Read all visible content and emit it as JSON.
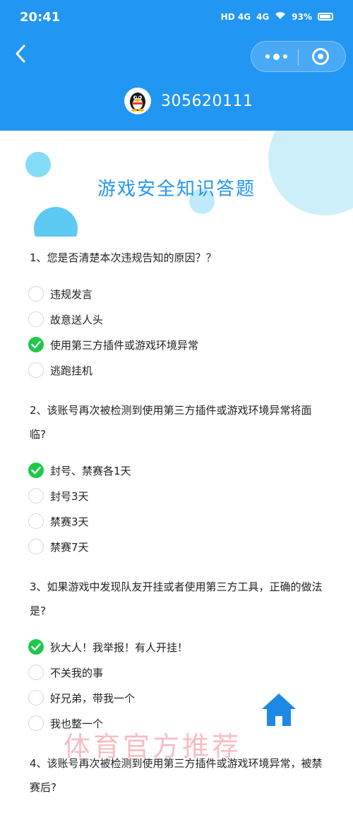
{
  "status_bar": {
    "time": "20:41",
    "network_1": "HD 4G",
    "network_2": "4G",
    "battery": "93%"
  },
  "nav": {
    "back_icon": "chevron-left-icon",
    "more_icon": "more-dots-icon",
    "close_icon": "target-close-icon"
  },
  "account": {
    "avatar_icon": "qq-penguin-icon",
    "number": "305620111"
  },
  "banner": {
    "title": "游戏安全知识答题"
  },
  "questions": [
    {
      "text": "1、您是否清楚本次违规告知的原因？？",
      "options": [
        {
          "label": "违规发言",
          "checked": false
        },
        {
          "label": "故意送人头",
          "checked": false
        },
        {
          "label": "使用第三方插件或游戏环境异常",
          "checked": true
        },
        {
          "label": "逃跑挂机",
          "checked": false
        }
      ]
    },
    {
      "text": "2、该账号再次被检测到使用第三方插件或游戏环境异常将面临?",
      "options": [
        {
          "label": "封号、禁赛各1天",
          "checked": true
        },
        {
          "label": "封号3天",
          "checked": false
        },
        {
          "label": "禁赛3天",
          "checked": false
        },
        {
          "label": "禁赛7天",
          "checked": false
        }
      ]
    },
    {
      "text": "3、如果游戏中发现队友开挂或者使用第三方工具，正确的做法是?",
      "options": [
        {
          "label": "狄大人！我举报！有人开挂！",
          "checked": true
        },
        {
          "label": "不关我的事",
          "checked": false
        },
        {
          "label": "好兄弟，带我一个",
          "checked": false
        },
        {
          "label": "我也整一个",
          "checked": false
        }
      ]
    },
    {
      "text": "4、该账号再次被检测到使用第三方插件或游戏环境异常，被禁赛后?",
      "options": []
    }
  ],
  "home_icon": "home-icon",
  "watermark": "体育官方推荐",
  "colors": {
    "header": "#2196f3",
    "title": "#2196f3",
    "check": "#1fc84a",
    "bubble": "#7fd6f5"
  }
}
